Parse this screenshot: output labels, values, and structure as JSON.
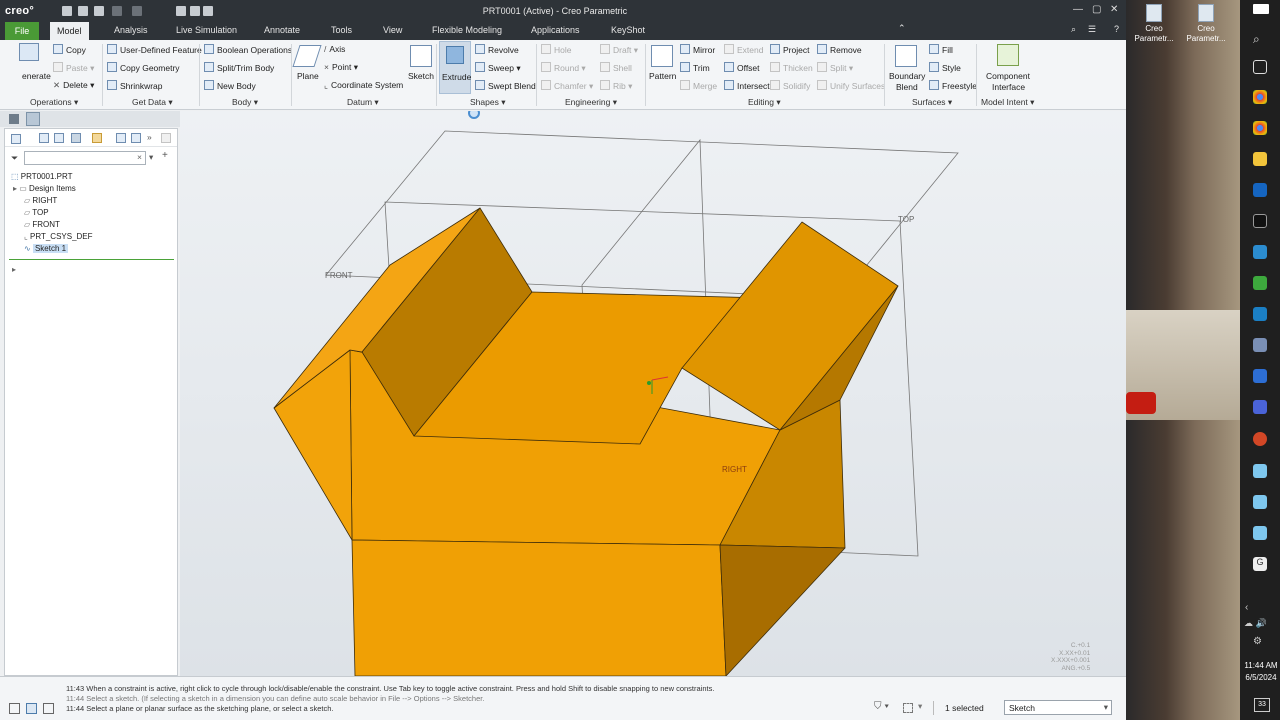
{
  "titlebar": {
    "logo": "creo°",
    "title": "PRT0001 (Active) - Creo Parametric"
  },
  "menu_tabs": [
    "File",
    "Model",
    "Analysis",
    "Live Simulation",
    "Annotate",
    "Tools",
    "View",
    "Flexible Modeling",
    "Applications",
    "KeyShot"
  ],
  "ribbon": {
    "operations": {
      "regenerate": "enerate",
      "copy": "Copy",
      "paste": "Paste",
      "delete": "Delete",
      "group": "Operations"
    },
    "get_data": {
      "udf": "User-Defined Feature",
      "copy_geometry": "Copy Geometry",
      "shrinkwrap": "Shrinkwrap",
      "group": "Get Data"
    },
    "body": {
      "boolean": "Boolean Operations",
      "split_trim": "Split/Trim Body",
      "new_body": "New Body",
      "group": "Body"
    },
    "datum": {
      "plane": "Plane",
      "axis": "Axis",
      "point": "Point",
      "coord": "Coordinate System",
      "sketch": "Sketch",
      "group": "Datum"
    },
    "shapes": {
      "extrude": "Extrude",
      "revolve": "Revolve",
      "sweep": "Sweep",
      "swept_blend": "Swept Blend",
      "group": "Shapes"
    },
    "engineering": {
      "hole": "Hole",
      "draft": "Draft",
      "round": "Round",
      "shell": "Shell",
      "chamfer": "Chamfer",
      "rib": "Rib",
      "group": "Engineering"
    },
    "editing": {
      "pattern": "Pattern",
      "mirror": "Mirror",
      "extend": "Extend",
      "project": "Project",
      "remove": "Remove",
      "trim": "Trim",
      "offset": "Offset",
      "thicken": "Thicken",
      "split": "Split",
      "merge": "Merge",
      "intersect": "Intersect",
      "solidify": "Solidify",
      "unify": "Unify Surfaces",
      "group": "Editing"
    },
    "surfaces": {
      "boundary": "Boundary",
      "blend": "Blend",
      "fill": "Fill",
      "style": "Style",
      "freestyle": "Freestyle",
      "group": "Surfaces"
    },
    "model_intent": {
      "component": "Component",
      "interface": "Interface",
      "group": "Model Intent"
    }
  },
  "tree": {
    "root": "PRT0001.PRT",
    "items": [
      "Design Items",
      "RIGHT",
      "TOP",
      "FRONT",
      "PRT_CSYS_DEF",
      "Sketch 1"
    ]
  },
  "viewport": {
    "labels": {
      "front": "FRONT",
      "top": "TOP",
      "right": "RIGHT"
    },
    "legend": [
      "C.+0.1",
      "X.XX+0.01",
      "X.XXX+0.001",
      "ANG.+0.5"
    ]
  },
  "status": {
    "messages": [
      "11:43 When a constraint is active, right click to cycle through lock/disable/enable the constraint. Use Tab key to toggle active constraint. Press and hold Shift to disable snapping to new constraints.",
      "11:44 Select a sketch. (If selecting a sketch in a dimension you can define auto scale behavior in File --> Options --> Sketcher.",
      "11:44 Select a plane or planar surface as the sketching plane, or select a sketch."
    ],
    "selected": "1 selected",
    "filter": "Sketch"
  },
  "desktop": {
    "icons": [
      "Creo Parametr...",
      "Creo Parametr..."
    ]
  },
  "taskbar": {
    "time": "11:44 AM",
    "date": "6/5/2024",
    "notif": "33"
  }
}
